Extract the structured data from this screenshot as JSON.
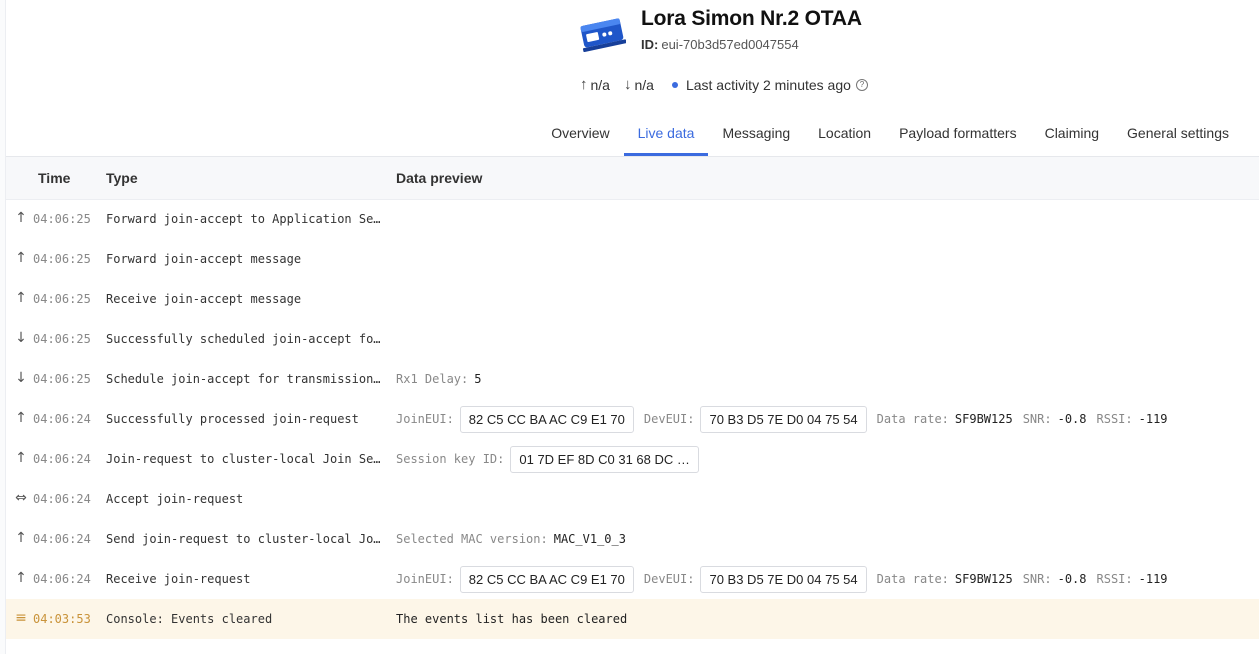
{
  "device": {
    "name": "Lora Simon Nr.2 OTAA",
    "id_label": "ID:",
    "id": "eui-70b3d57ed0047554",
    "uplink": "n/a",
    "downlink": "n/a",
    "last_activity": "Last activity 2 minutes ago"
  },
  "tabs": [
    "Overview",
    "Live data",
    "Messaging",
    "Location",
    "Payload formatters",
    "Claiming",
    "General settings"
  ],
  "table": {
    "columns": [
      "Time",
      "Type",
      "Data preview"
    ],
    "labels": {
      "joineui": "JoinEUI:",
      "deveui": "DevEUI:",
      "data_rate": "Data rate:",
      "snr": "SNR:",
      "rssi": "RSSI:",
      "rx1_delay": "Rx1 Delay:",
      "session_key": "Session key ID:",
      "mac_version": "Selected MAC version:"
    },
    "rows": [
      {
        "icon": "up-arrow-icon",
        "time": "04:06:25",
        "type": "Forward join-accept to Application Se…"
      },
      {
        "icon": "up-arrow-icon",
        "time": "04:06:25",
        "type": "Forward join-accept message"
      },
      {
        "icon": "up-arrow-icon",
        "time": "04:06:25",
        "type": "Receive join-accept message"
      },
      {
        "icon": "down-arrow-icon",
        "time": "04:06:25",
        "type": "Successfully scheduled join-accept fo…"
      },
      {
        "icon": "down-arrow-icon",
        "time": "04:06:25",
        "type": "Schedule join-accept for transmission…",
        "rx1_delay": "5"
      },
      {
        "icon": "up-arrow-icon",
        "time": "04:06:24",
        "type": "Successfully processed join-request",
        "joineui": "82 C5 CC BA AC C9 E1 70",
        "deveui": "70 B3 D5 7E D0 04 75 54",
        "data_rate": "SF9BW125",
        "snr": "-0.8",
        "rssi": "-119"
      },
      {
        "icon": "up-arrow-icon",
        "time": "04:06:24",
        "type": "Join-request to cluster-local Join Se…",
        "session_key": "01 7D EF 8D C0 31 68 DC …"
      },
      {
        "icon": "link-icon",
        "time": "04:06:24",
        "type": "Accept join-request"
      },
      {
        "icon": "up-arrow-icon",
        "time": "04:06:24",
        "type": "Send join-request to cluster-local Jo…",
        "mac_version": "MAC_V1_0_3"
      },
      {
        "icon": "up-arrow-icon",
        "time": "04:06:24",
        "type": "Receive join-request",
        "joineui": "82 C5 CC BA AC C9 E1 70",
        "deveui": "70 B3 D5 7E D0 04 75 54",
        "data_rate": "SF9BW125",
        "snr": "-0.8",
        "rssi": "-119"
      },
      {
        "icon": "event-lines-icon",
        "time": "04:03:53",
        "type": "Console: Events cleared",
        "message": "The events list has been cleared"
      }
    ]
  },
  "colors": {
    "accent": "#3b6bdf",
    "highlight_row": "#fdf6e8",
    "highlight_text": "#c9933a"
  }
}
